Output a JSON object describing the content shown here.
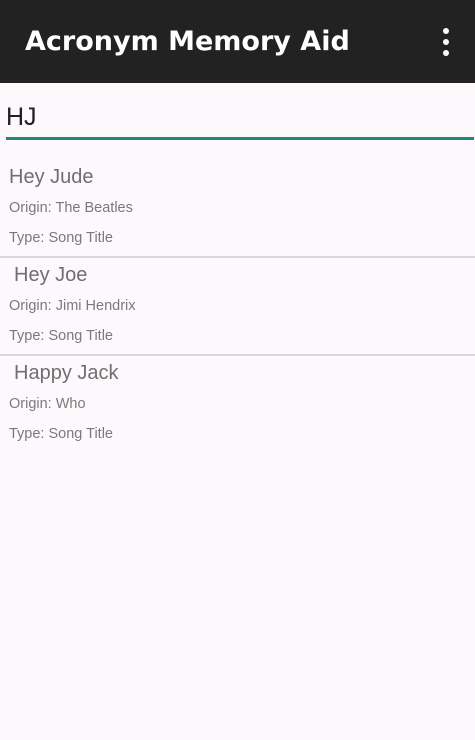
{
  "app_bar": {
    "title": "Acronym Memory Aid",
    "menu_icon": "more-vert-icon",
    "background": "#222222"
  },
  "search": {
    "value": "HJ",
    "accent": "#1a8a80"
  },
  "results": [
    {
      "title": "Hey Jude",
      "origin": "Origin: The Beatles",
      "type": "Type: Song Title"
    },
    {
      "title": "Hey Joe",
      "origin": "Origin: Jimi Hendrix",
      "type": "Type: Song Title"
    },
    {
      "title": "Happy Jack",
      "origin": "Origin: Who",
      "type": "Type: Song Title"
    }
  ]
}
